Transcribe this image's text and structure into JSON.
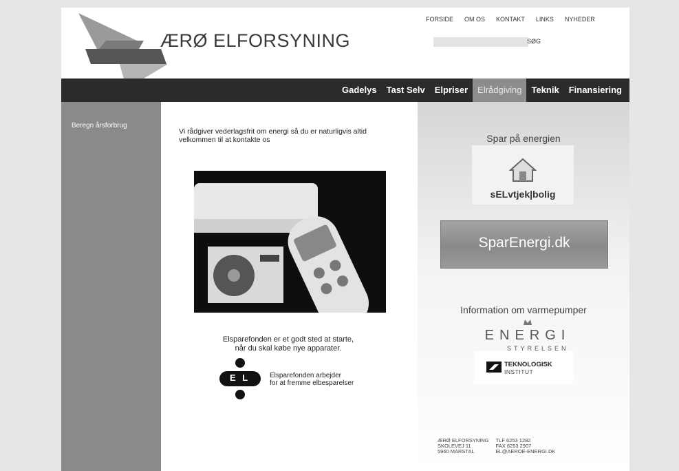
{
  "header": {
    "title": "ÆRØ ELFORSYNING",
    "top_nav": [
      "FORSIDE",
      "OM OS",
      "KONTAKT",
      "LINKS",
      "NYHEDER"
    ],
    "search_label": "SØG",
    "search_value": ""
  },
  "main_nav": {
    "items": [
      "Gadelys",
      "Tast Selv",
      "Elpriser",
      "Elrådgiving",
      "Teknik",
      "Finansiering"
    ],
    "active": "Elrådgiving"
  },
  "sidebar": {
    "items": [
      "Beregn årsforbrug"
    ]
  },
  "content": {
    "intro": "Vi rådgiver vederlagsfrit om energi så du er naturligvis altid velkommen til at kontakte os",
    "elsparefonden_text_1": "Elsparefonden er et godt sted at starte,",
    "elsparefonden_text_2": "når du skal købe nye apparater.",
    "el_logo_letters": "E L",
    "el_logo_tagline_1": "Elsparefonden arbejder",
    "el_logo_tagline_2": "for at fremme elbesparelser"
  },
  "right": {
    "spar_title": "Spar på energien",
    "selvtjek_label": "sELvtjek|bolig",
    "sparenergi_label": "SparEnergi.dk",
    "vp_title": "Information om varmepumper",
    "energi_logo_text": "ENERGI",
    "energi_logo_sub": "STYRELSEN",
    "ti_line1": "TEKNOLOGISK",
    "ti_line2": "INSTITUT"
  },
  "footer": {
    "col1": [
      "ÆRØ ELFORSYNING",
      "SKOLEVEJ 11",
      "5960 MARSTAL"
    ],
    "col2": [
      "TLF 6253 1282",
      "FAX 6253 2907",
      "EL@AEROE-ENERGI.DK"
    ]
  },
  "colors": {
    "nav_bg": "#2b2b2b",
    "nav_active": "#8c8c8c",
    "sidebar_bg": "#8a8a8a"
  }
}
